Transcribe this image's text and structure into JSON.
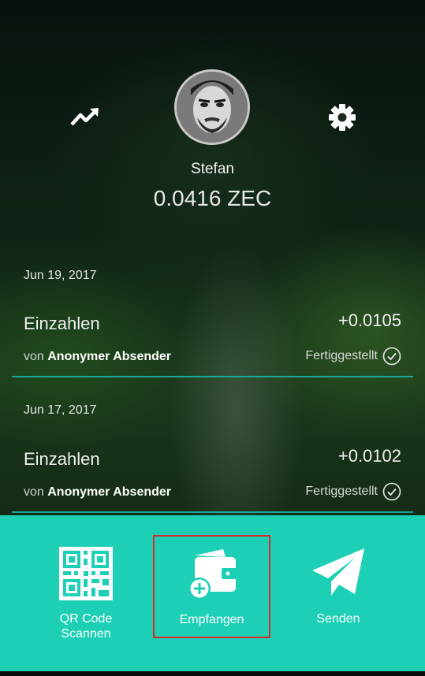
{
  "header": {
    "username": "Stefan",
    "balance": "0.0416 ZEC"
  },
  "transactions": [
    {
      "date": "Jun 19, 2017",
      "title": "Einzahlen",
      "amount": "+0.0105",
      "from_prefix": "von",
      "from_name": "Anonymer Absender",
      "status": "Fertiggestellt"
    },
    {
      "date": "Jun 17, 2017",
      "title": "Einzahlen",
      "amount": "+0.0102",
      "from_prefix": "von",
      "from_name": "Anonymer Absender",
      "status": "Fertiggestellt"
    }
  ],
  "actions": {
    "qr_line1": "QR Code",
    "qr_line2": "Scannen",
    "receive": "Empfangen",
    "send": "Senden"
  },
  "colors": {
    "accent": "#1ccfb5",
    "divider": "#1aa89a",
    "highlight": "#d92a2a"
  },
  "icons": [
    "trending-up-icon",
    "gear-icon",
    "qr-code-icon",
    "wallet-add-icon",
    "paper-plane-icon",
    "check-circle-icon"
  ]
}
